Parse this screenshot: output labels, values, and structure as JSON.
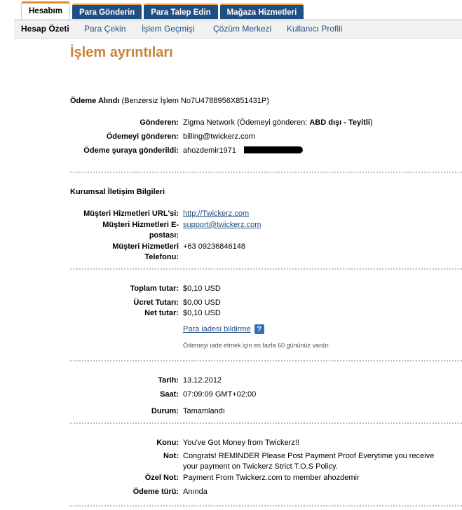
{
  "tabs": [
    {
      "label": "Hesabım",
      "active": true
    },
    {
      "label": "Para Gönderin",
      "active": false
    },
    {
      "label": "Para Talep Edin",
      "active": false
    },
    {
      "label": "Mağaza Hizmetleri",
      "active": false
    }
  ],
  "subnav": [
    "Hesap Özeti",
    "Para Çekin",
    "İşlem Geçmişi",
    "Çözüm Merkezi",
    "Kullanıcı Profili"
  ],
  "page": {
    "title": "İşlem ayrıntıları"
  },
  "payment": {
    "heading_bold": "Ödeme Alındı",
    "heading_rest": " (Benzersiz İşlem No7U4788956X851431P)",
    "sender_label": "Gönderen:",
    "sender_value": "Zigma Network (Ödemeyi gönderen: ",
    "sender_value_bold": "ABD dışı - Teyitli",
    "sender_value_end": ")",
    "payer_label": "Ödemeyi gönderen:",
    "payer_value": "billing@twickerz.com",
    "recipient_label": "Ödeme şuraya gönderildi:",
    "recipient_value": "ahozdemir1971"
  },
  "corporate": {
    "heading": "Kurumsal İletişim Bilgileri",
    "url_label": "Müşteri Hizmetleri URL'si:",
    "url_value": "http://Twickerz.com",
    "email_label_1": "Müşteri Hizmetleri E-",
    "email_label_2": "postası:",
    "email_value": "support@twickerz.com",
    "phone_label_1": "Müşteri Hizmetleri",
    "phone_label_2": "Telefonu:",
    "phone_value": "+63 09236846148"
  },
  "amounts": {
    "total_label": "Toplam tutar:",
    "total_value": "$0,10 USD",
    "fee_label": "Ücret Tutarı:",
    "fee_value": "$0,00 USD",
    "net_label": "Net tutar:",
    "net_value": "$0,10 USD",
    "refund_link": "Para iadesi bildirme",
    "refund_help": "?",
    "refund_note": "Ödemeyi iade etmek için en fazla 60 gününüz vardır."
  },
  "status": {
    "date_label": "Tarih:",
    "date_value": "13.12.2012",
    "time_label": "Saat:",
    "time_value": "07:09:09 GMT+02:00",
    "state_label": "Durum:",
    "state_value": "Tamamlandı"
  },
  "message": {
    "subject_label": "Konu:",
    "subject_value": "You've Got Money from Twickerz!!",
    "note_label": "Not:",
    "note_line1": "Congrats! REMINDER Please Post Payment Proof Everytime you receive",
    "note_line2": "your payment on Twickerz Strict T.O.S Policy.",
    "private_label": "Özel Not:",
    "private_value": "Payment From Twickerz.com to member ahozdemir",
    "type_label": "Ödeme türü:",
    "type_value": "Anında"
  }
}
